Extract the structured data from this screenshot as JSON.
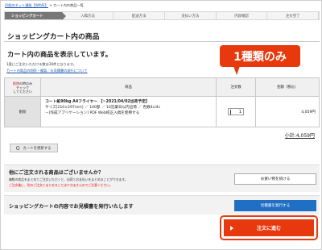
{
  "breadcrumb": {
    "home": "印刷のネット通販【WAVE】",
    "separator": ">",
    "current": "カート内の商品一覧"
  },
  "steps": [
    "ショッピングカート",
    "入稿方法",
    "配送方法",
    "支払い方法",
    "内容確認",
    "注文完了"
  ],
  "page": {
    "title": "ショッピングカート内の商品",
    "subtitle": "カート内の商品を表示しています。",
    "note": "1度にご注文いただける数は30件となります。",
    "link": "カート内商品の削除・複製／お見積書の発行について"
  },
  "callout": "1種類のみ",
  "table": {
    "headers": {
      "delete_red": "削除",
      "delete_rest": "の時のみ",
      "delete_line2": "チェック",
      "delete_line3": "してください",
      "product": "商品",
      "qty": "注文数",
      "amount": "金額（税込）"
    },
    "rows": [
      {
        "delete": "削除",
        "name": "コート紙90kg A4フライヤー 【~2021/04/02出荷予定】",
        "line2": "サイズ[210×297mm] ／ 100部 ／ 10営業日以内出荷 ／ 色数4c/4c",
        "line3": "－[作成アプリケーション] PDF Web校正入稿を使用する",
        "qty": "1",
        "amount": "4,059円"
      }
    ]
  },
  "subtotal": "小計:4,059円",
  "update_button": "カートを更新する",
  "other": {
    "title": "他にご注文される商品はございませんか？",
    "text1": "複数の商品をまとめてご注文いただくと、出荷とお支払いをまとめることができます。",
    "text2": "ご注文後に、別のご注文とまとめることはできませんのでご注意ください。",
    "button": "お買い物を続ける"
  },
  "estimate": {
    "title": "ショッピングカートの内容でお見積書を発行いたします",
    "button": "見積書を発行する"
  },
  "order_button": "注文に進む"
}
